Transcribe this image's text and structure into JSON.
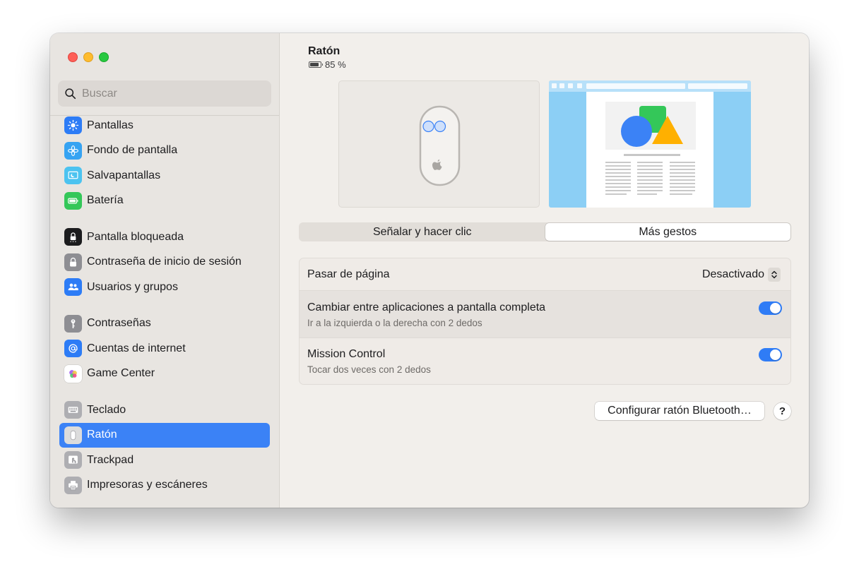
{
  "sidebar": {
    "search_placeholder": "Buscar",
    "items": [
      {
        "label": "Pantallas",
        "icon": "display-brightness-icon",
        "color": "#2d7cf6"
      },
      {
        "label": "Fondo de pantalla",
        "icon": "wallpaper-flower-icon",
        "color": "#36a3f2"
      },
      {
        "label": "Salvapantallas",
        "icon": "screensaver-icon",
        "color": "#4cc3f0"
      },
      {
        "label": "Batería",
        "icon": "battery-icon",
        "color": "#34c759"
      },
      {
        "label": "Pantalla bloqueada",
        "icon": "lock-screen-icon",
        "color": "#1c1c1e"
      },
      {
        "label": "Contraseña de inicio de sesión",
        "icon": "padlock-icon",
        "color": "#8e8e93"
      },
      {
        "label": "Usuarios y grupos",
        "icon": "users-group-icon",
        "color": "#2d7cf6"
      },
      {
        "label": "Contraseñas",
        "icon": "key-icon",
        "color": "#8e8e93"
      },
      {
        "label": "Cuentas de internet",
        "icon": "at-sign-icon",
        "color": "#2d7cf6"
      },
      {
        "label": "Game Center",
        "icon": "game-center-icon",
        "color": "#ffffff"
      },
      {
        "label": "Teclado",
        "icon": "keyboard-icon",
        "color": "#aeaeb2"
      },
      {
        "label": "Ratón",
        "icon": "mouse-icon",
        "color": "#aeaeb2"
      },
      {
        "label": "Trackpad",
        "icon": "trackpad-icon",
        "color": "#aeaeb2"
      },
      {
        "label": "Impresoras y escáneres",
        "icon": "printer-icon",
        "color": "#aeaeb2"
      }
    ],
    "active_index": 11,
    "accent_color": "#3b82f6"
  },
  "main": {
    "device_title": "Ratón",
    "battery_text": "85 %",
    "tabs": [
      {
        "label": "Señalar y hacer clic",
        "selected": false
      },
      {
        "label": "Más gestos",
        "selected": true
      }
    ],
    "settings": [
      {
        "title": "Pasar de página",
        "value": "Desactivado",
        "control": "popup"
      },
      {
        "title": "Cambiar entre aplicaciones a pantalla completa",
        "subtitle": "Ir a la izquierda o la derecha con 2 dedos",
        "control": "toggle",
        "on": true
      },
      {
        "title": "Mission Control",
        "subtitle": "Tocar dos veces con 2 dedos",
        "control": "toggle",
        "on": true
      }
    ],
    "bluetooth_button": "Configurar ratón Bluetooth…",
    "help_button": "?",
    "toggle_color": "#2f7cf6"
  }
}
